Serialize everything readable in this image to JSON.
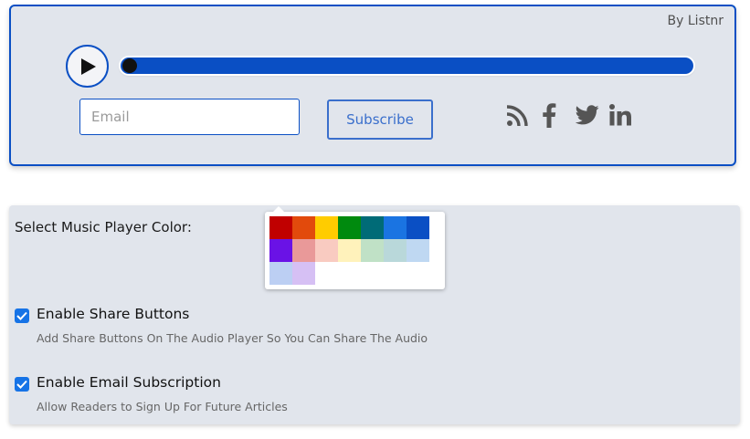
{
  "player": {
    "credit": "By Listnr",
    "progress": 0.0,
    "email_placeholder": "Email",
    "subscribe_label": "Subscribe",
    "accent_color": "#0a4fc4",
    "share_icons": [
      "rss-icon",
      "facebook-icon",
      "twitter-icon",
      "linkedin-icon"
    ]
  },
  "settings": {
    "color_label": "Select Music Player Color:",
    "swatches": [
      "#c00000",
      "#e24a0c",
      "#ffcc00",
      "#008a0e",
      "#006b77",
      "#1a74e2",
      "#0a4fc4",
      "#6a12e6",
      "#e99999",
      "#f9cbc1",
      "#fff2bb",
      "#c0e1c6",
      "#b9d8da",
      "#bfd8f2",
      "#bccff3",
      "#d6c0f4"
    ],
    "options": [
      {
        "title": "Enable Share Buttons",
        "description": "Add Share Buttons On The Audio Player So You Can Share The Audio",
        "checked": true
      },
      {
        "title": "Enable Email Subscription",
        "description": "Allow Readers to Sign Up For Future Articles",
        "checked": true
      }
    ]
  }
}
